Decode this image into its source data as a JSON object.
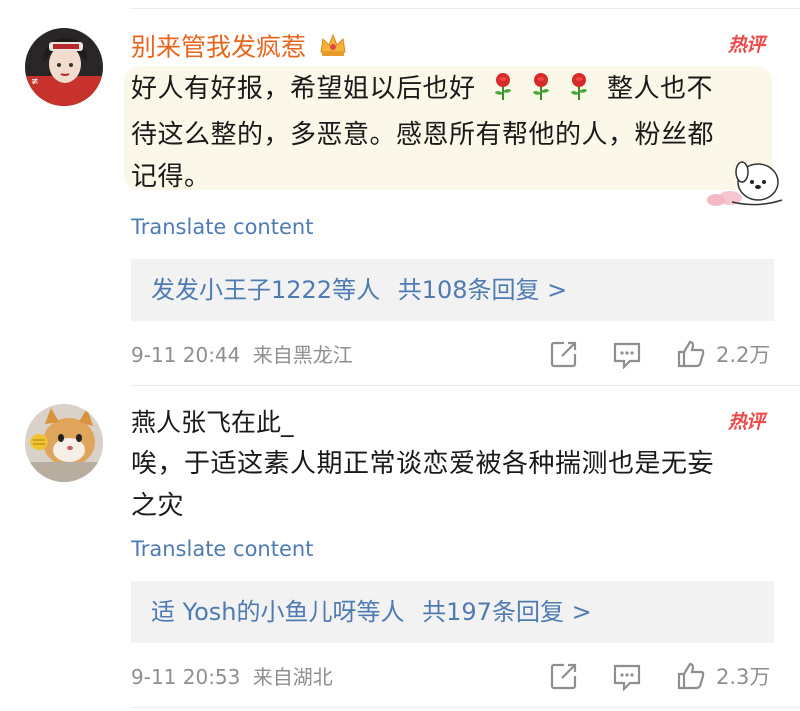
{
  "comments": [
    {
      "username": "别来管我发疯惹",
      "username_color": "#e8651c",
      "badge": "热评",
      "body_line1": "好人有好报，希望姐以后也好 ",
      "body_line1_tail": " 整人也不",
      "body_line2": "待这么整的，多恶意。感恩所有帮他的人，粉丝都",
      "body_line3": "记得。",
      "emoji": [
        "rose-icon",
        "rose-icon",
        "rose-icon"
      ],
      "translate": "Translate content",
      "reply_users": "发发小王子1222",
      "reply_mid": "等人",
      "reply_count": "共108条回复 >",
      "time": "9-11 20:44",
      "location": "来自黑龙江",
      "likes": "2.2万"
    },
    {
      "username": "燕人张飞在此_",
      "username_color": "#1a1a1a",
      "badge": "热评",
      "body_line1": "唉，于适这素人期正常谈恋爱被各种揣测也是无妄",
      "body_line2": "之灾",
      "translate": "Translate content",
      "reply_users": "适 Yosh的小鱼儿呀",
      "reply_mid": "等人",
      "reply_count": "共197条回复 >",
      "time": "9-11 20:53",
      "location": "来自湖北",
      "likes": "2.3万"
    }
  ],
  "colors": {
    "link": "#4f7bb3",
    "hot": "#ec4b4b",
    "muted": "#8f8f8f"
  }
}
